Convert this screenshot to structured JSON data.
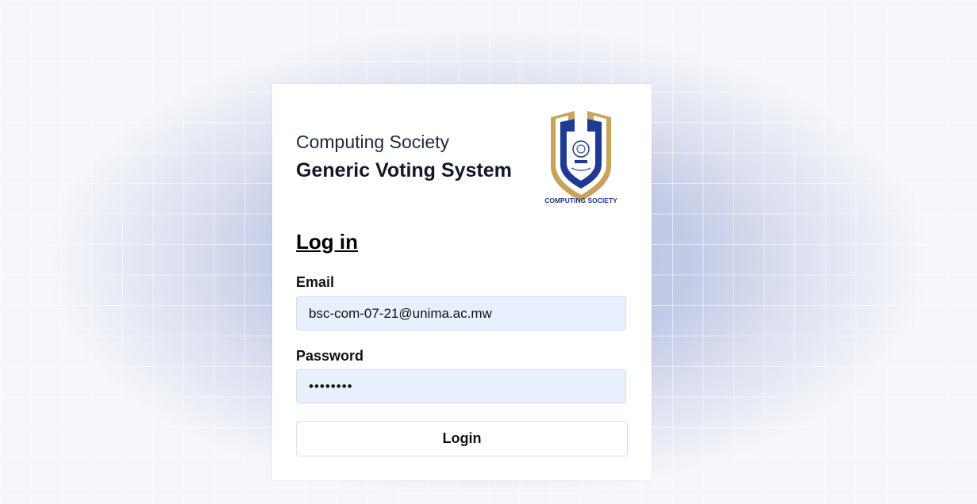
{
  "header": {
    "organization": "Computing Society",
    "app_title": "Generic Voting System"
  },
  "logo": {
    "icon": "computing-society-shield-logo",
    "caption": "COMPUTING SOCIETY",
    "colors": {
      "gold": "#c9a35a",
      "navy": "#1f3a93"
    }
  },
  "form": {
    "heading": "Log in",
    "email_label": "Email",
    "email_value": "bsc-com-07-21@unima.ac.mw",
    "password_label": "Password",
    "password_value": "password",
    "submit_label": "Login"
  },
  "colors": {
    "input_background": "#e8f0fe",
    "background_tint": "#b7c0e0"
  }
}
